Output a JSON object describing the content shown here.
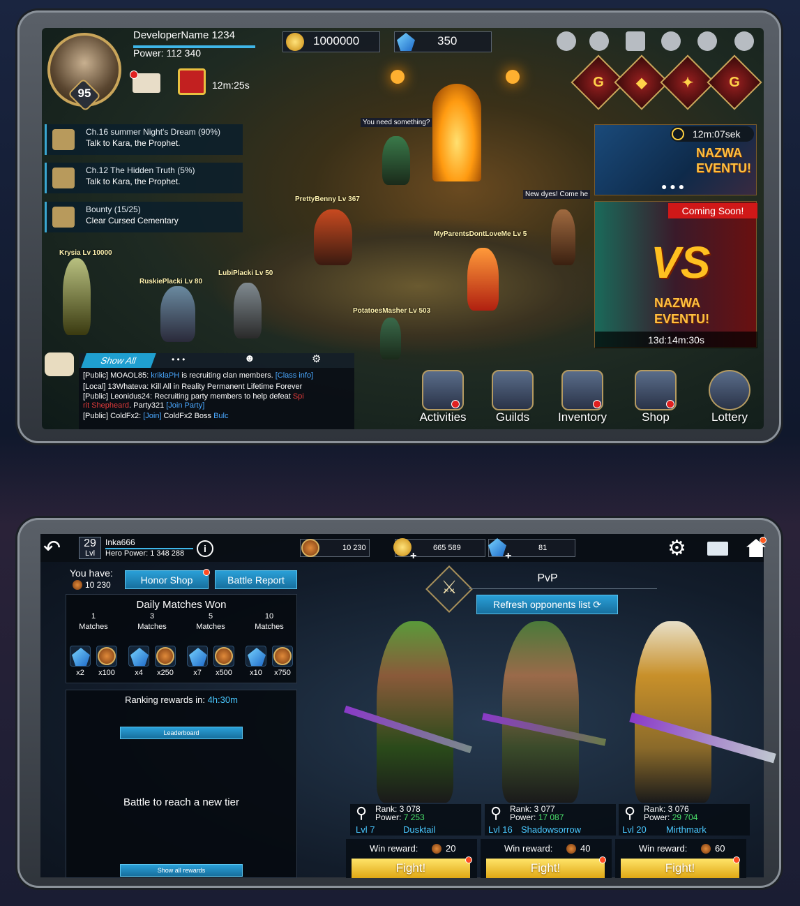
{
  "top": {
    "player": {
      "name": "DeveloperName 1234",
      "power": "Power: 112 340",
      "level": "95"
    },
    "timer": "12m:25s",
    "resources": {
      "gold": "1000000",
      "gems": "350"
    },
    "quests": [
      {
        "title": "Ch.16 summer Night's Dream (90%)",
        "desc": "Talk to Kara, the Prophet."
      },
      {
        "title": "Ch.12 The Hidden Truth (5%)",
        "desc": "Talk to Kara, the Prophet."
      },
      {
        "title": "Bounty (15/25)",
        "desc": "Clear Cursed Cementary"
      }
    ],
    "bubbles": {
      "npc": "You need something?",
      "dyes": "New dyes! Come he"
    },
    "players": [
      {
        "label": "PrettyBenny Lv 367"
      },
      {
        "label": "MyParentsDontLoveMe Lv 5"
      },
      {
        "label": "Krysia Lv 10000"
      },
      {
        "label": "RuskiePlacki Lv 80"
      },
      {
        "label": "LubiPlacki Lv 50"
      },
      {
        "label": "PotatoesMasher Lv 503"
      }
    ],
    "banners": [
      {
        "timer": "12m:07sek",
        "text1": "NAZWA",
        "text2": "EVENTU!"
      },
      {
        "tag": "Coming Soon!",
        "vs": "VS",
        "text1": "NAZWA",
        "text2": "EVENTU!",
        "timer": "13d:14m:30s"
      }
    ],
    "chat": {
      "tab": "Show All",
      "dots": "• • •",
      "lines": [
        [
          "[Public] MOAOL85: ",
          "kriklaPH",
          " is recruiting clan members. ",
          "[Class info]"
        ],
        [
          "[Local] 13Whateva: Kill All in Reality Permanent Lifetime Forever"
        ],
        [
          "[Public] Leonidus24: Recruiting party members to help defeat ",
          "Spi",
          ""
        ],
        [
          "",
          "rit Shepheard",
          ". Party321 ",
          "[Join Party]"
        ],
        [
          "[Public] ColdFx2: ",
          "[Join]",
          " ColdFx2 Boss ",
          "Bulc"
        ]
      ]
    },
    "menu": [
      "Activities",
      "Guilds",
      "Inventory",
      "Shop",
      "Lottery"
    ],
    "icons": [
      "trophy-icon",
      "helmet-icon",
      "window-icon",
      "friends-icon",
      "piggy-bank-icon",
      "gear-icon"
    ]
  },
  "bottom": {
    "level": "29",
    "level_label": "Lvl",
    "name": "Inka666",
    "hero_power": "Hero Power: 1 348 288",
    "info_icon": "i",
    "medals": "10 230",
    "gold": "665 589",
    "gems": "81",
    "you_have": "You have:",
    "you_have_val": "10 230",
    "honor_shop": "Honor Shop",
    "battle_report": "Battle Report",
    "daily_title": "Daily Matches Won",
    "tiers": [
      {
        "n": "1",
        "label": "Matches",
        "r1": "x2",
        "r2": "x100"
      },
      {
        "n": "3",
        "label": "Matches",
        "r1": "x4",
        "r2": "x250"
      },
      {
        "n": "5",
        "label": "Matches",
        "r1": "x7",
        "r2": "x500"
      },
      {
        "n": "10",
        "label": "Matches",
        "r1": "x10",
        "r2": "x750"
      }
    ],
    "ranking_label": "Ranking rewards in: ",
    "ranking_time": "4h:30m",
    "leaderboard": "Leaderboard",
    "tier_msg": "Battle to reach a new tier",
    "show_all": "Show all rewards",
    "pvp": "PvP",
    "refresh": "Refresh opponents list ⟳",
    "opponents": [
      {
        "rank": "Rank: 3 078",
        "power_label": "Power: ",
        "power": "7 253",
        "lvl": "Lvl 7",
        "name": "Dusktail",
        "win_label": "Win reward: ",
        "reward": "20",
        "fight": "Fight!"
      },
      {
        "rank": "Rank: 3 077",
        "power_label": "Power: ",
        "power": "17 087",
        "lvl": "Lvl 16",
        "name": "Shadowsorrow",
        "win_label": "Win reward: ",
        "reward": "40",
        "fight": "Fight!"
      },
      {
        "rank": "Rank: 3 076",
        "power_label": "Power: ",
        "power": "29 704",
        "lvl": "Lvl 20",
        "name": "Mirthmark",
        "win_label": "Win reward: ",
        "reward": "60",
        "fight": "Fight!"
      }
    ]
  }
}
